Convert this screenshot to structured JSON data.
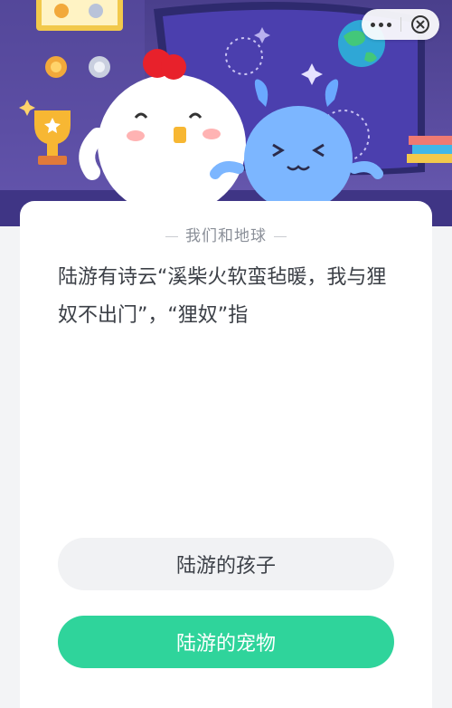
{
  "header": {
    "close_icon": "close-icon",
    "more_icon": "more-icon"
  },
  "quiz": {
    "category": "我们和地球",
    "question": "陆游有诗云“溪柴火软蛮毡暖，我与狸奴不出门”，“狸奴”指",
    "options": [
      {
        "label": "陆游的孩子"
      },
      {
        "label": "陆游的宠物"
      }
    ]
  },
  "colors": {
    "hero_background": "#5a4ca0",
    "option_neutral": "#f1f2f4",
    "option_highlight": "#2fd49b"
  }
}
